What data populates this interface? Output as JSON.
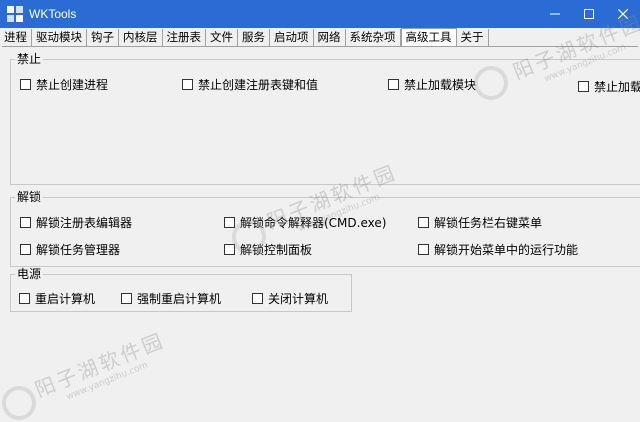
{
  "window": {
    "title": "WKTools"
  },
  "tabs": [
    {
      "label": "进程"
    },
    {
      "label": "驱动模块"
    },
    {
      "label": "钩子"
    },
    {
      "label": "内核层"
    },
    {
      "label": "注册表"
    },
    {
      "label": "文件"
    },
    {
      "label": "服务"
    },
    {
      "label": "启动项"
    },
    {
      "label": "网络"
    },
    {
      "label": "系统杂项"
    },
    {
      "label": "高级工具"
    },
    {
      "label": "关于"
    }
  ],
  "active_tab": "高级工具",
  "groups": {
    "disable": {
      "label": "禁止",
      "items": [
        {
          "label": "禁止创建进程",
          "checked": false
        },
        {
          "label": "禁止创建注册表键和值",
          "checked": false
        },
        {
          "label": "禁止加载模块",
          "checked": false
        },
        {
          "label": "禁止加载",
          "checked": false
        }
      ]
    },
    "unlock": {
      "label": "解锁",
      "items": [
        {
          "label": "解锁注册表编辑器",
          "checked": false
        },
        {
          "label": "解锁命令解释器(CMD.exe)",
          "checked": false
        },
        {
          "label": "解锁任务栏右键菜单",
          "checked": false
        },
        {
          "label": "解锁任务管理器",
          "checked": false
        },
        {
          "label": "解锁控制面板",
          "checked": false
        },
        {
          "label": "解锁开始菜单中的运行功能",
          "checked": false
        }
      ]
    },
    "power": {
      "label": "电源",
      "items": [
        {
          "label": "重启计算机",
          "checked": false
        },
        {
          "label": "强制重启计算机",
          "checked": false
        },
        {
          "label": "关闭计算机",
          "checked": false
        }
      ]
    }
  },
  "watermark": {
    "text": "阳子湖软件园",
    "url": "www.yangzihu.com"
  }
}
